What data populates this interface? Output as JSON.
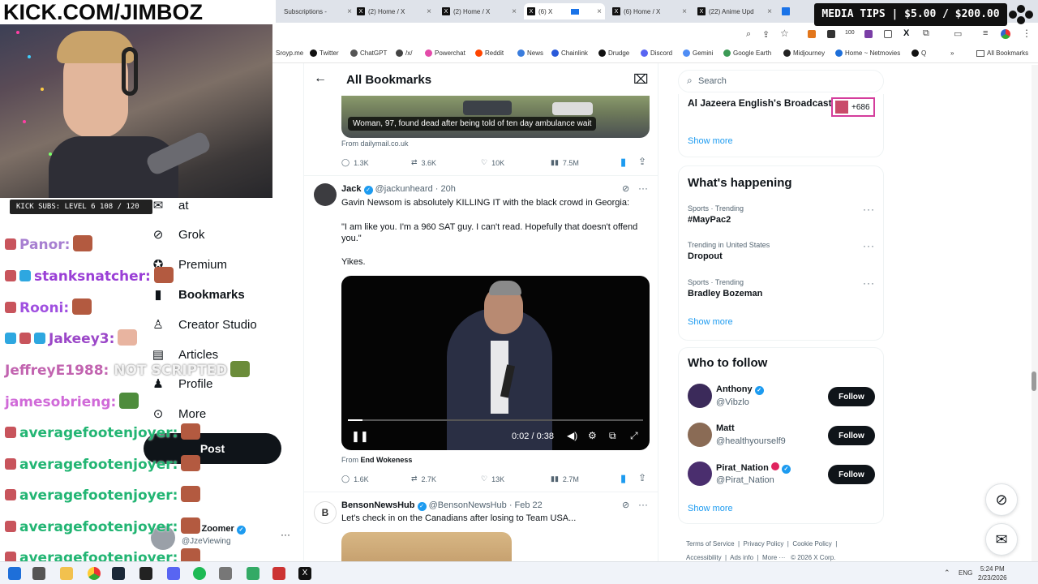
{
  "stream": {
    "channel_banner": "KICK.COM/JIMBOZ",
    "subs_bar": "KICK SUBS: LEVEL 6 108 / 120",
    "media_tips": "MEDIA TIPS | $5.00 / $200.00",
    "chat": [
      {
        "user": "Panor:",
        "color": "#a77fd1"
      },
      {
        "user": "stanksnatcher:",
        "color": "#9a3fd6"
      },
      {
        "user": "Rooni:",
        "color": "#a050e0"
      },
      {
        "user": "Jakeey3:",
        "color": "#9b47c8"
      },
      {
        "user": "JeffreyE1988:",
        "color": "#c264b0",
        "text": "NOT SCRIPTED"
      },
      {
        "user": "jamesobrieng:",
        "color": "#d06ad8"
      },
      {
        "user": "averagefootenjoyer:",
        "color": "#22b573"
      },
      {
        "user": "averagefootenjoyer:",
        "color": "#22b573"
      },
      {
        "user": "averagefootenjoyer:",
        "color": "#22b573"
      },
      {
        "user": "averagefootenjoyer:",
        "color": "#22b573"
      },
      {
        "user": "averagefootenjoyer:",
        "color": "#22b573"
      }
    ]
  },
  "browser": {
    "tabs": [
      {
        "label": "Subscriptions -"
      },
      {
        "label": "(2) Home / X"
      },
      {
        "label": "(2) Home / X"
      },
      {
        "label": "(6) X"
      },
      {
        "label": "(6) Home / X"
      },
      {
        "label": "(22) Anime Upd"
      }
    ],
    "bookmarks": [
      {
        "label": "Sroyp.me",
        "color": "#888"
      },
      {
        "label": "Twitter",
        "color": "#111"
      },
      {
        "label": "ChatGPT",
        "color": "#333"
      },
      {
        "label": "/x/",
        "color": "#444"
      },
      {
        "label": "Powerchat",
        "color": "#e34ba9"
      },
      {
        "label": "Reddit",
        "color": "#ff4500"
      },
      {
        "label": "News",
        "color": "#3b7ddd"
      },
      {
        "label": "Chainlink",
        "color": "#2a5ada"
      },
      {
        "label": "Drudge",
        "color": "#111"
      },
      {
        "label": "Discord",
        "color": "#5865f2"
      },
      {
        "label": "Gemini",
        "color": "#4f8df5"
      },
      {
        "label": "Google Earth",
        "color": "#3c9a55"
      },
      {
        "label": "Midjourney",
        "color": "#222"
      },
      {
        "label": "Home ~ Netmovies",
        "color": "#1e6fd9"
      },
      {
        "label": "Q",
        "color": "#111"
      }
    ],
    "all_bookmarks": "All Bookmarks"
  },
  "nav": {
    "items": [
      {
        "label": "at",
        "icon": "chat-icon"
      },
      {
        "label": "Grok",
        "icon": "grok-icon"
      },
      {
        "label": "Premium",
        "icon": "verified-icon"
      },
      {
        "label": "Bookmarks",
        "icon": "bookmark-icon"
      },
      {
        "label": "Creator Studio",
        "icon": "creator-icon"
      },
      {
        "label": "Articles",
        "icon": "articles-icon"
      },
      {
        "label": "Profile",
        "icon": "profile-icon"
      },
      {
        "label": "More",
        "icon": "more-icon"
      }
    ],
    "post_label": "Post",
    "account": {
      "name": "Zoomer",
      "handle": "@JzeViewing",
      "prefix": "J"
    }
  },
  "center": {
    "header_title": "All Bookmarks",
    "tweet1": {
      "image_caption": "Woman, 97, found dead after being told of ten day ambulance wait",
      "source": "From dailymail.co.uk",
      "replies": "1.3K",
      "reposts": "3.6K",
      "likes": "10K",
      "views": "7.5M"
    },
    "tweet2": {
      "name": "Jack",
      "handle": "@jackunheard",
      "time": "· 20h",
      "line1": "Gavin Newsom is absolutely KILLING IT with the black crowd in Georgia:",
      "line2": "\"I am like you. I'm a 960 SAT guy. I can't read. Hopefully that doesn't offend you.\"",
      "line3": "Yikes.",
      "video_time": "0:02 / 0:38",
      "video_progress": 0.05,
      "from_prefix": "From",
      "from_name": "End Wokeness",
      "replies": "1.6K",
      "reposts": "2.7K",
      "likes": "13K",
      "views": "2.7M"
    },
    "tweet3": {
      "name": "BensonNewsHub",
      "handle": "@BensonNewsHub",
      "time": "· Feb 22",
      "text": "Let's check in on the Canadians after losing to Team USA..."
    }
  },
  "right": {
    "search_placeholder": "Search",
    "live": {
      "title": "Al Jazeera English's Broadcast",
      "count": "+686"
    },
    "show_more_1": "Show more",
    "happening_title": "What's happening",
    "trends": [
      {
        "context": "Sports · Trending",
        "name": "#MayPac2"
      },
      {
        "context": "Trending in United States",
        "name": "Dropout"
      },
      {
        "context": "Sports · Trending",
        "name": "Bradley Bozeman"
      }
    ],
    "show_more_2": "Show more",
    "follow_title": "Who to follow",
    "follows": [
      {
        "name": "Anthony",
        "handle": "@Vibzlo",
        "button": "Follow",
        "avatar_color": "#3b2a5a"
      },
      {
        "name": "Matt",
        "handle": "@healthyourself9",
        "button": "Follow",
        "avatar_color": "#8a6b55"
      },
      {
        "name": "Pirat_Nation",
        "handle": "@Pirat_Nation",
        "button": "Follow",
        "avatar_color": "#4a2e6e"
      }
    ],
    "show_more_3": "Show more",
    "footer": [
      "Terms of Service",
      "Privacy Policy",
      "Cookie Policy",
      "Accessibility",
      "Ads info",
      "More ···",
      "© 2026 X Corp."
    ]
  },
  "taskbar": {
    "lang": "ENG",
    "time": "5:24 PM",
    "date": "2/23/2026"
  }
}
